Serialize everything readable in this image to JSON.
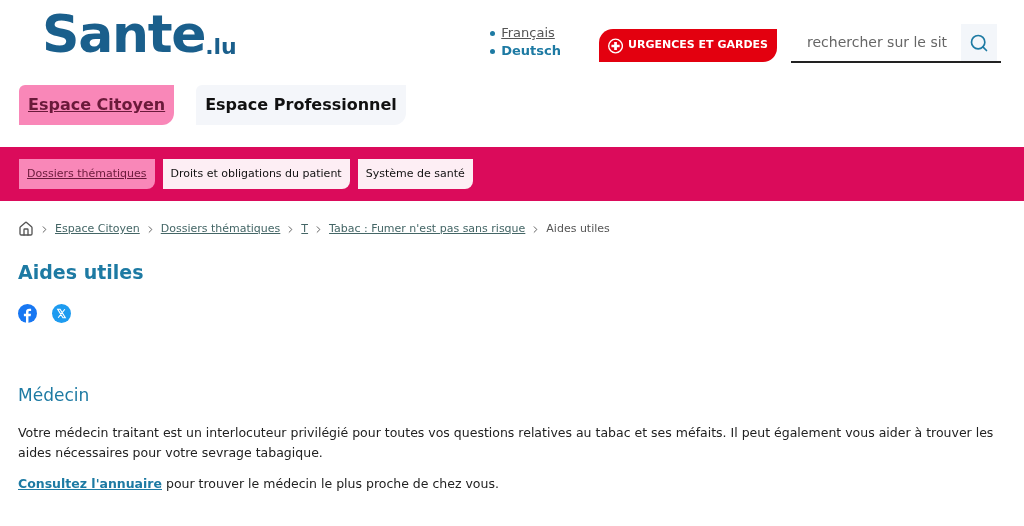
{
  "logo": {
    "name": "Sante",
    "suffix": ".lu"
  },
  "languages": [
    {
      "label": "Français",
      "selected": true
    },
    {
      "label": "Deutsch",
      "selected": false
    }
  ],
  "emergency_button": "URGENCES ET GARDES",
  "search": {
    "placeholder": "rechercher sur le sit"
  },
  "spaces": [
    {
      "label": "Espace Citoyen",
      "selected": true
    },
    {
      "label": "Espace Professionnel",
      "selected": false
    }
  ],
  "subnav": [
    {
      "label": "Dossiers thématiques",
      "selected": true
    },
    {
      "label": "Droits et obligations du patient",
      "selected": false
    },
    {
      "label": "Système de santé",
      "selected": false
    }
  ],
  "breadcrumb": [
    {
      "label": "Espace Citoyen",
      "link": true
    },
    {
      "label": "Dossiers thématiques",
      "link": true
    },
    {
      "label": "T",
      "link": true
    },
    {
      "label": "Tabac : Fumer n'est pas sans risque",
      "link": true
    },
    {
      "label": "Aides utiles",
      "link": false
    }
  ],
  "title": "Aides utiles",
  "section": {
    "heading": "Médecin",
    "paragraph": "Votre médecin traitant est un interlocuteur privilégié pour toutes vos questions relatives au tabac et ses méfaits. Il peut également vous aider à trouver les aides nécessaires pour votre sevrage tabagique.",
    "link": "Consultez l'annuaire",
    "link_text": "pour trouver le médecin le plus proche de chez vous."
  }
}
